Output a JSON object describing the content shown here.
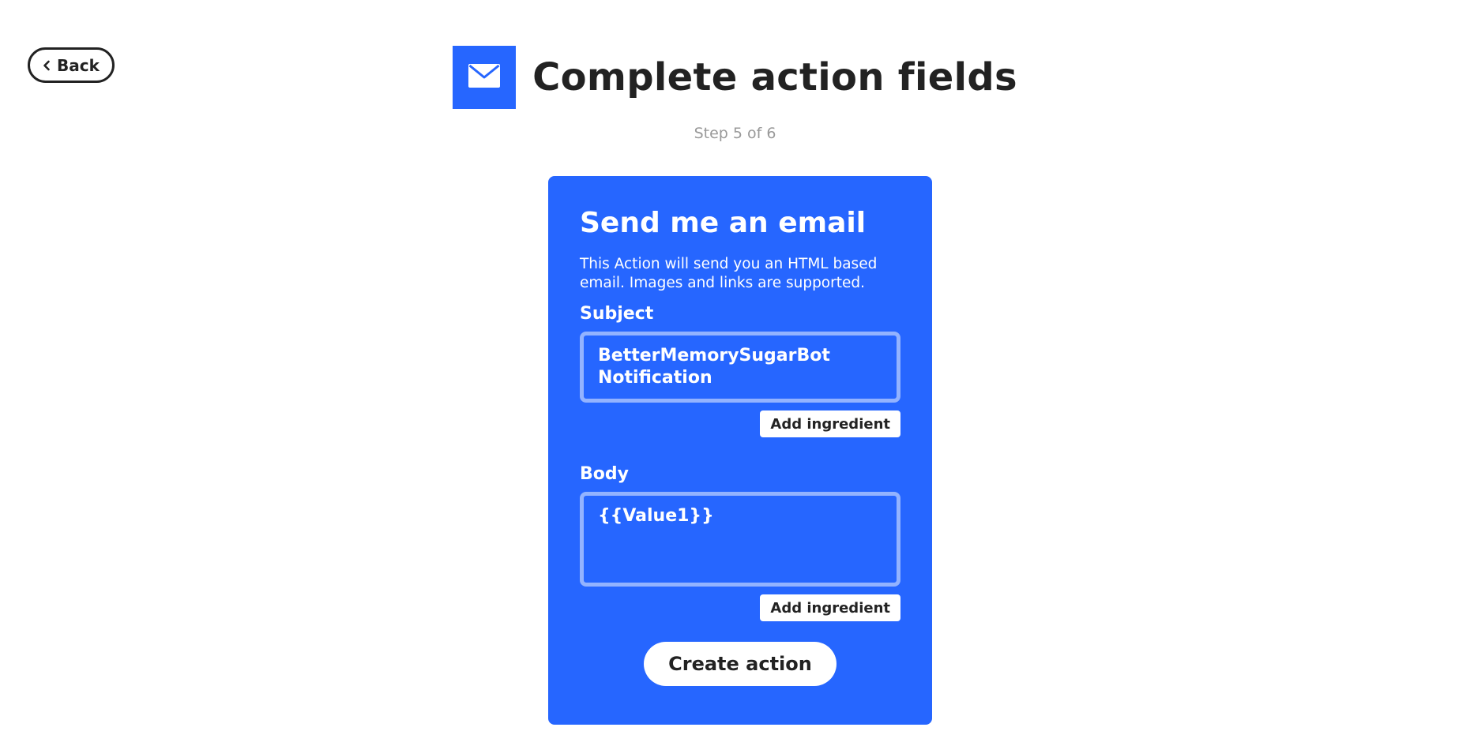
{
  "header": {
    "back_label": "Back",
    "title": "Complete action fields",
    "step_text": "Step 5 of 6"
  },
  "service": {
    "icon": "envelope-icon",
    "color": "#2666FF"
  },
  "card": {
    "color": "#2666FF",
    "title": "Send me an email",
    "description": "This Action will send you an HTML based email. Images and links are supported.",
    "fields": [
      {
        "label": "Subject",
        "value": "BetterMemorySugarBot Notification",
        "ingredient_label": "Add ingredient"
      },
      {
        "label": "Body",
        "value": "{{Value1}}",
        "ingredient_label": "Add ingredient"
      }
    ],
    "submit_label": "Create action"
  }
}
